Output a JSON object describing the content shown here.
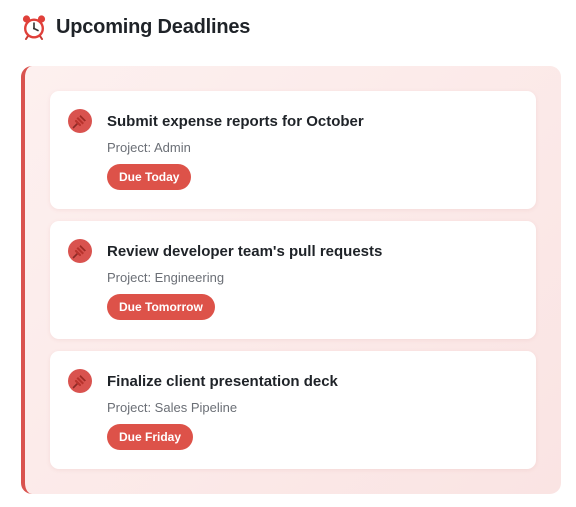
{
  "header": {
    "icon": "alarm-clock-icon",
    "title": "Upcoming Deadlines"
  },
  "colors": {
    "accent": "#d9534f",
    "badge": "#dd5249",
    "panel_bg": "#fbeae9",
    "title_text": "#1f2328",
    "muted_text": "#6b6f76"
  },
  "deadlines": [
    {
      "icon": "pushpin-icon",
      "title": "Submit expense reports for October",
      "project": "Project: Admin",
      "due": "Due Today"
    },
    {
      "icon": "pushpin-icon",
      "title": "Review developer team's pull requests",
      "project": "Project: Engineering",
      "due": "Due Tomorrow"
    },
    {
      "icon": "pushpin-icon",
      "title": "Finalize client presentation deck",
      "project": "Project: Sales Pipeline",
      "due": "Due Friday"
    }
  ]
}
